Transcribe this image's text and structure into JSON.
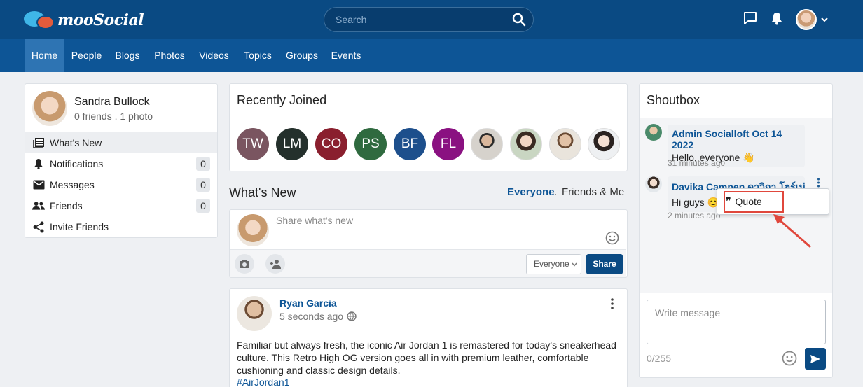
{
  "brand": {
    "name": "mooSocial"
  },
  "search": {
    "placeholder": "Search"
  },
  "nav": [
    {
      "label": "Home"
    },
    {
      "label": "People"
    },
    {
      "label": "Blogs"
    },
    {
      "label": "Photos"
    },
    {
      "label": "Videos"
    },
    {
      "label": "Topics"
    },
    {
      "label": "Groups"
    },
    {
      "label": "Events"
    }
  ],
  "profile": {
    "name": "Sandra Bullock",
    "meta": "0 friends . 1 photo",
    "menu": [
      {
        "label": "What's New",
        "icon": "news-icon"
      },
      {
        "label": "Notifications",
        "icon": "bell-icon",
        "count": "0"
      },
      {
        "label": "Messages",
        "icon": "envelope-icon",
        "count": "0"
      },
      {
        "label": "Friends",
        "icon": "people-icon",
        "count": "0"
      },
      {
        "label": "Invite Friends",
        "icon": "share-icon"
      }
    ]
  },
  "recently_joined": {
    "title": "Recently Joined",
    "members": [
      {
        "initials": "TW",
        "color": "#7a5560"
      },
      {
        "initials": "LM",
        "color": "#24302c"
      },
      {
        "initials": "CO",
        "color": "#8a1f2e"
      },
      {
        "initials": "PS",
        "color": "#2f6a3f"
      },
      {
        "initials": "BF",
        "color": "#1d4f8c"
      },
      {
        "initials": "FL",
        "color": "#8a1181"
      }
    ]
  },
  "whats_new": {
    "title": "What's New",
    "filter_everyone": "Everyone",
    "filter_sep": ".",
    "filter_friends": "Friends & Me",
    "composer_placeholder": "Share what's new",
    "privacy": "Everyone",
    "share_label": "Share"
  },
  "post": {
    "author": "Ryan Garcia",
    "time": "5 seconds ago",
    "text_lines": [
      "Familiar but always fresh, the iconic Air Jordan 1 is remastered for today's sneakerhead",
      "culture. This Retro High OG version goes all in with premium leather, comfortable",
      "cushioning and classic design details."
    ],
    "hashtag": "#AirJordan1"
  },
  "shoutbox": {
    "title": "Shoutbox",
    "messages": [
      {
        "name": "Admin Socialloft Oct 14 2022",
        "text": "Hello, everyone",
        "emoji": "👋",
        "time": "31 minutes ago"
      },
      {
        "name": "Davika Campen ดาวิกา โฮร์เน่",
        "text": "Hi guys",
        "emoji": "😊",
        "time": "2 minutes ago"
      }
    ],
    "context_menu": {
      "quote_label": "Quote"
    },
    "input_placeholder": "Write message",
    "char_count": "0/255"
  }
}
